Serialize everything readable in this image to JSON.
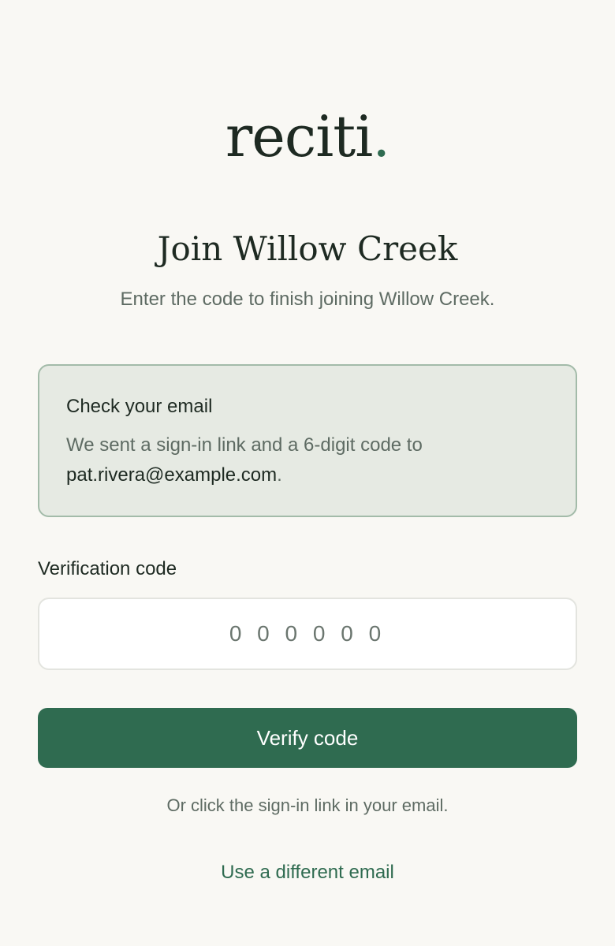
{
  "brand": {
    "name": "reciti",
    "dot": ".",
    "accent_color": "#2f6b50"
  },
  "page": {
    "title": "Join Willow Creek",
    "subtitle": "Enter the code to finish joining Willow Creek."
  },
  "notice": {
    "title": "Check your email",
    "body": "We sent a sign-in link and a 6-digit code to",
    "email": "pat.rivera@example.com",
    "trailing": "."
  },
  "form": {
    "code_label": "Verification code",
    "code_placeholder": "0 0 0 0 0 0",
    "code_value": "",
    "verify_label": "Verify code"
  },
  "footer": {
    "hint": "Or click the sign-in link in your email.",
    "alt_link": "Use a different email"
  }
}
